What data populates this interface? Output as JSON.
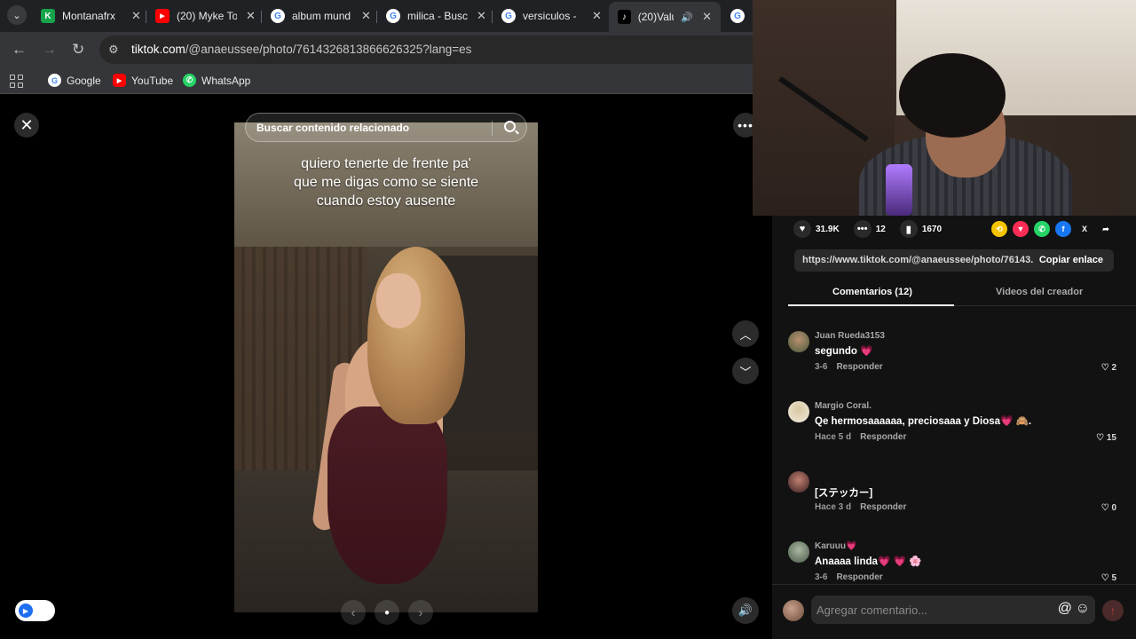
{
  "browser": {
    "tabs": [
      {
        "title": "Montanafrx",
        "fav_color": "#16a34a",
        "fav_glyph": "K"
      },
      {
        "title": "(20) Myke To",
        "fav_color": "#ff0000",
        "fav_glyph": "▶"
      },
      {
        "title": "album mund",
        "fav_color": "#ffffff",
        "fav_glyph": "G"
      },
      {
        "title": "milica - Busc",
        "fav_color": "#ffffff",
        "fav_glyph": "G"
      },
      {
        "title": "versiculos -",
        "fav_color": "#ffffff",
        "fav_glyph": "G"
      },
      {
        "title": "(20)Valu",
        "fav_color": "#000000",
        "fav_glyph": "♪"
      }
    ],
    "address": {
      "host": "tiktok.com",
      "path": "/@anaeussee/photo/7614326813866626325?lang=es"
    },
    "bookmarks": [
      {
        "label": "Google",
        "icon": "google-icon",
        "color": "#ffffff"
      },
      {
        "label": "YouTube",
        "icon": "youtube-icon",
        "color": "#ff0000"
      },
      {
        "label": "WhatsApp",
        "icon": "whatsapp-icon",
        "color": "#25d366"
      }
    ]
  },
  "viewer": {
    "search_placeholder": "Buscar contenido relacionado",
    "caption_lines": [
      "quiero tenerte de frente pa'",
      "que me digas como se siente",
      "cuando estoy ausente"
    ]
  },
  "side": {
    "likes": "31.9K",
    "comments_count": "12",
    "saves": "1670",
    "share_url": "https://www.tiktok.com/@anaeussee/photo/76143...",
    "copy_label": "Copiar enlace",
    "tab_comments": "Comentarios (12)",
    "tab_creator": "Videos del creador",
    "comments": [
      {
        "user": "Juan Rueda3153",
        "text": "segundo 💗",
        "date": "3-6",
        "reply": "Responder",
        "likes": "2",
        "avatar_color": "#5a6b4a"
      },
      {
        "user": "Margio Coral.",
        "text": "Qe hermosaaaaaa, preciosaaa y Diosa💗 🙈.",
        "date": "Hace 5 d",
        "reply": "Responder",
        "likes": "15",
        "avatar_color": "#e8e0d0"
      },
      {
        "user": "",
        "text": "[ステッカー]",
        "date": "Hace 3 d",
        "reply": "Responder",
        "likes": "0",
        "avatar_color": "#7a4a3a"
      },
      {
        "user": "Karuuu💗",
        "text": "Anaaaa linda💗 💗 🌸",
        "date": "3-6",
        "reply": "Responder",
        "likes": "5",
        "avatar_color": "#6a7a6a"
      }
    ],
    "input_placeholder": "Agregar comentario..."
  }
}
